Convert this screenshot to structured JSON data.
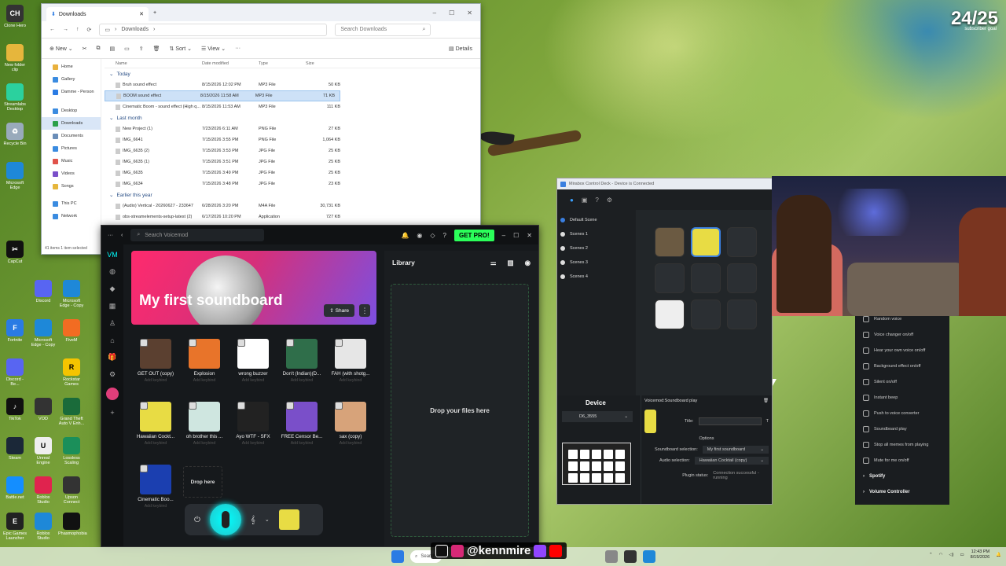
{
  "overlay": {
    "counter": "24/25",
    "counter_sub": "subscriber goal"
  },
  "desktop": {
    "icons": [
      "Clone Hero",
      "New folder clip",
      "Streamlabs Desktop",
      "Recycle Bin",
      "Microsoft Edge",
      "CapCut",
      "Discord",
      "Microsoft Edge - Copy",
      "Fortnite",
      "Microsoft Edge - Copy",
      "FiveM",
      "Discord - Be...",
      "Rockstar Games",
      "TikTok",
      "VOD",
      "Grand Theft Auto V Enh...",
      "Steam",
      "Unreal Engine",
      "Lossless Scaling",
      "Battle.net",
      "Roblox Studio",
      "Upson Connect",
      "Epic Games Launcher",
      "Roblox Studio",
      "Phasmophobia",
      "OBS",
      "Firefox"
    ]
  },
  "explorer": {
    "tab_title": "Downloads",
    "breadcrumb": "Downloads",
    "search_placeholder": "Search Downloads",
    "toolbar": {
      "new": "New",
      "sort": "Sort",
      "view": "View",
      "more": "···",
      "details": "Details"
    },
    "sidebar": [
      "Home",
      "Gallery",
      "Damme - Person",
      "Desktop",
      "Downloads",
      "Documents",
      "Pictures",
      "Music",
      "Videos",
      "Songs",
      "This PC",
      "Network"
    ],
    "columns": {
      "name": "Name",
      "date": "Date modified",
      "type": "Type",
      "size": "Size"
    },
    "groups": [
      {
        "label": "Today",
        "rows": [
          {
            "name": "Bruh sound effect",
            "date": "8/15/2026 12:02 PM",
            "type": "MP3 File",
            "size": "50 KB",
            "selected": false
          },
          {
            "name": "BOOM sound effect",
            "date": "8/15/2026 11:58 AM",
            "type": "MP3 File",
            "size": "71 KB",
            "selected": true
          },
          {
            "name": "Cinematic Boom - sound effect (High q...",
            "date": "8/15/2026 11:53 AM",
            "type": "MP3 File",
            "size": "111 KB",
            "selected": false
          }
        ]
      },
      {
        "label": "Last month",
        "rows": [
          {
            "name": "New Project (1)",
            "date": "7/23/2026 6:11 AM",
            "type": "PNG File",
            "size": "27 KB",
            "selected": false
          },
          {
            "name": "IMG_6641",
            "date": "7/15/2026 3:55 PM",
            "type": "PNG File",
            "size": "1,064 KB",
            "selected": false
          },
          {
            "name": "IMG_6635 (2)",
            "date": "7/15/2026 3:53 PM",
            "type": "JPG File",
            "size": "25 KB",
            "selected": false
          },
          {
            "name": "IMG_6635 (1)",
            "date": "7/15/2026 3:51 PM",
            "type": "JPG File",
            "size": "25 KB",
            "selected": false
          },
          {
            "name": "IMG_6635",
            "date": "7/15/2026 3:49 PM",
            "type": "JPG File",
            "size": "25 KB",
            "selected": false
          },
          {
            "name": "IMG_6634",
            "date": "7/15/2026 3:48 PM",
            "type": "JPG File",
            "size": "23 KB",
            "selected": false
          }
        ]
      },
      {
        "label": "Earlier this year",
        "rows": [
          {
            "name": "(Audio) Vertical - 20260627 - 233647",
            "date": "6/28/2026 3:20 PM",
            "type": "M4A File",
            "size": "30,731 KB",
            "selected": false
          },
          {
            "name": "obs-streamelements-setup-latest (2)",
            "date": "6/17/2026 10:20 PM",
            "type": "Application",
            "size": "727 KB",
            "selected": false
          }
        ]
      }
    ],
    "status": "41 items  1 item selected"
  },
  "voicemod": {
    "search_placeholder": "Search Voicemod",
    "getpro": "GET PRO!",
    "banner_title": "My first soundboard",
    "share": "Share",
    "library": "Library",
    "drop_files": "Drop your files here",
    "drop_here": "Drop here",
    "add_keybind": "Add keybind",
    "pads": [
      {
        "label": "GET OUT (copy)",
        "color": "#5b4030"
      },
      {
        "label": "Explosion",
        "color": "#e8742a"
      },
      {
        "label": "wrong buzzer",
        "color": "#ffffff"
      },
      {
        "label": "Don't (Indian)(D...",
        "color": "#2f6e4a"
      },
      {
        "label": "FAH (with shotg...",
        "color": "#e6e6e6"
      },
      {
        "label": "Hawaiian Cockt...",
        "color": "#e8dc44"
      },
      {
        "label": "oh brother this ...",
        "color": "#cfe6e0"
      },
      {
        "label": "Ayo WTF - SFX",
        "color": "#222222"
      },
      {
        "label": "FREE Censor Be...",
        "color": "#7a4fc9"
      },
      {
        "label": "sax (copy)",
        "color": "#d7a37a"
      },
      {
        "label": "Cinematic Boo...",
        "color": "#1b3fb0"
      }
    ]
  },
  "mirabox": {
    "title": "Mirabox Control Deck - Device is Connected",
    "scenes": [
      "Default Scene",
      "Scenes 1",
      "Scenes 2",
      "Scenes 3",
      "Scenes 4"
    ],
    "pages": [
      "1",
      "2",
      "3",
      "+"
    ],
    "device_label": "Device",
    "device_name": "D6_3555",
    "action_title": "Voicemod:Soundboard play",
    "title_label": "Title:",
    "options_label": "Options",
    "soundboard_selection_label": "Soundboard selection:",
    "soundboard_selection": "My first soundboard",
    "audio_selection_label": "Audio selection:",
    "audio_selection": "Hawaiian Cocktail (copy)",
    "plugin_status_label": "Plugin status:",
    "plugin_status": "Connection successful - running"
  },
  "plugins": {
    "items": [
      "Random voice",
      "Voice changer on/off",
      "Hear your own voice on/off",
      "Background effect on/off",
      "Silent on/off",
      "Instant beep",
      "Push to voice converter",
      "Soundboard play",
      "Stop all memes from playing",
      "Mute for me on/off"
    ],
    "categories": [
      "Spotify",
      "Volume Controller"
    ]
  },
  "taskbar": {
    "search": "Search",
    "handle": "@kennmire",
    "time": "12:43 PM",
    "date": "8/15/2026"
  }
}
